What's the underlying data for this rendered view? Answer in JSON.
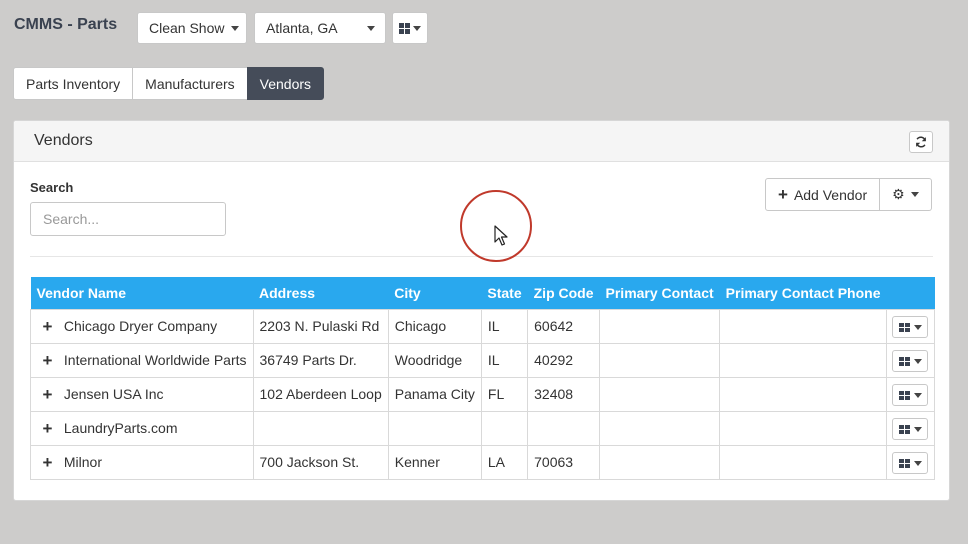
{
  "header": {
    "app_title": "CMMS - Parts",
    "show_select": "Clean Show",
    "location_select": "Atlanta, GA"
  },
  "tabs": [
    {
      "label": "Parts Inventory",
      "active": false
    },
    {
      "label": "Manufacturers",
      "active": false
    },
    {
      "label": "Vendors",
      "active": true
    }
  ],
  "panel": {
    "title": "Vendors",
    "search_label": "Search",
    "search_placeholder": "Search...",
    "add_button": "Add Vendor"
  },
  "table": {
    "columns": [
      "Vendor Name",
      "Address",
      "City",
      "State",
      "Zip Code",
      "Primary Contact",
      "Primary Contact Phone"
    ],
    "rows": [
      {
        "name": "Chicago Dryer Company",
        "address": "2203 N. Pulaski Rd",
        "city": "Chicago",
        "state": "IL",
        "zip": "60642",
        "contact": "",
        "phone": ""
      },
      {
        "name": "International Worldwide Parts",
        "address": "36749 Parts Dr.",
        "city": "Woodridge",
        "state": "IL",
        "zip": "40292",
        "contact": "",
        "phone": ""
      },
      {
        "name": "Jensen USA Inc",
        "address": "102 Aberdeen Loop",
        "city": "Panama City",
        "state": "FL",
        "zip": "32408",
        "contact": "",
        "phone": ""
      },
      {
        "name": "LaundryParts.com",
        "address": "",
        "city": "",
        "state": "",
        "zip": "",
        "contact": "",
        "phone": ""
      },
      {
        "name": "Milnor",
        "address": "700 Jackson St.",
        "city": "Kenner",
        "state": "LA",
        "zip": "70063",
        "contact": "",
        "phone": ""
      }
    ]
  },
  "colors": {
    "table_header": "#29a8ee",
    "active_tab": "#454c59",
    "cursor_highlight": "#c0392b"
  }
}
